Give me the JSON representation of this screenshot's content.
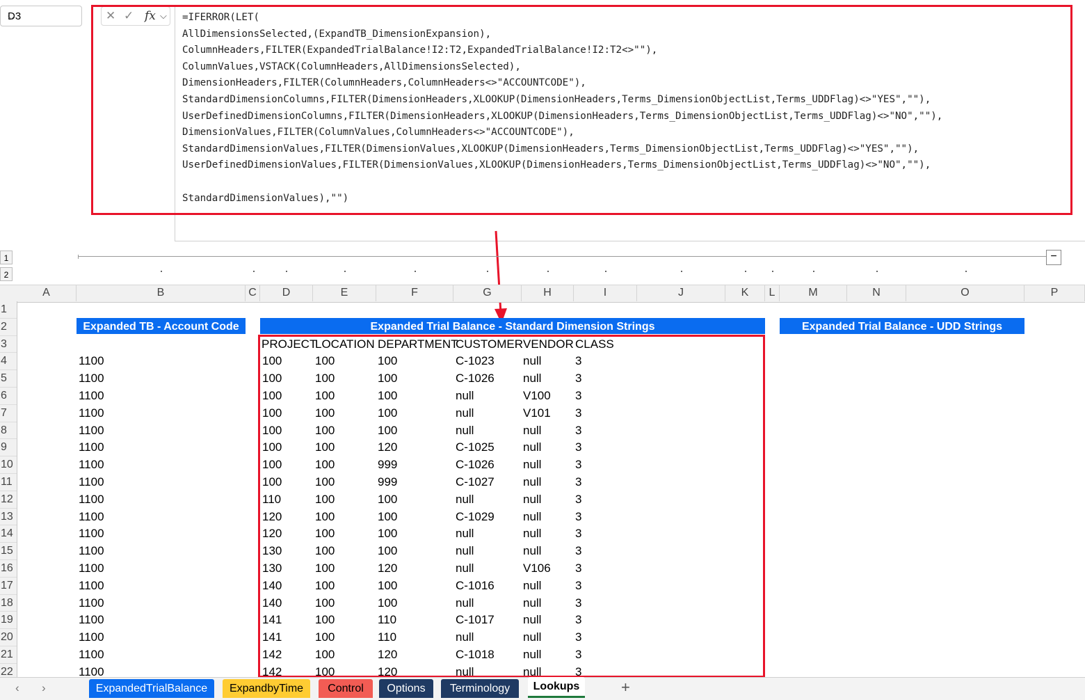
{
  "formula_bar": {
    "name_box": "D3",
    "fx_label": "fx",
    "formula_lines": [
      "=IFERROR(LET(",
      "AllDimensionsSelected,(ExpandTB_DimensionExpansion),",
      "ColumnHeaders,FILTER(ExpandedTrialBalance!I2:T2,ExpandedTrialBalance!I2:T2<>\"\"),",
      "ColumnValues,VSTACK(ColumnHeaders,AllDimensionsSelected),",
      "DimensionHeaders,FILTER(ColumnHeaders,ColumnHeaders<>\"ACCOUNTCODE\"),",
      "StandardDimensionColumns,FILTER(DimensionHeaders,XLOOKUP(DimensionHeaders,Terms_DimensionObjectList,Terms_UDDFlag)<>\"YES\",\"\"),",
      "UserDefinedDimensionColumns,FILTER(DimensionHeaders,XLOOKUP(DimensionHeaders,Terms_DimensionObjectList,Terms_UDDFlag)<>\"NO\",\"\"),",
      "DimensionValues,FILTER(ColumnValues,ColumnHeaders<>\"ACCOUNTCODE\"),",
      "StandardDimensionValues,FILTER(DimensionValues,XLOOKUP(DimensionHeaders,Terms_DimensionObjectList,Terms_UDDFlag)<>\"YES\",\"\"),",
      "UserDefinedDimensionValues,FILTER(DimensionValues,XLOOKUP(DimensionHeaders,Terms_DimensionObjectList,Terms_UDDFlag)<>\"NO\",\"\"),",
      "",
      "StandardDimensionValues),\"\")"
    ]
  },
  "outline": {
    "levels": [
      "1",
      "2"
    ],
    "collapse_symbol": "−"
  },
  "columns": [
    "A",
    "B",
    "C",
    "D",
    "E",
    "F",
    "G",
    "H",
    "I",
    "J",
    "K",
    "L",
    "M",
    "N",
    "O",
    "P"
  ],
  "rows": [
    "1",
    "2",
    "3",
    "4",
    "5",
    "6",
    "7",
    "8",
    "9",
    "10",
    "11",
    "12",
    "13",
    "14",
    "15",
    "16",
    "17",
    "18",
    "19",
    "20",
    "21",
    "22"
  ],
  "banners": {
    "account_code": "Expanded TB - Account Code",
    "standard_dims": "Expanded Trial Balance - Standard Dimension Strings",
    "udd_strings": "Expanded Trial Balance - UDD Strings"
  },
  "table": {
    "headers": [
      "PROJECT",
      "LOCATION",
      "DEPARTMENT",
      "CUSTOMER",
      "VENDOR",
      "CLASS"
    ],
    "rows": [
      [
        "1100",
        "100",
        "100",
        "100",
        "C-1023",
        "null",
        "3"
      ],
      [
        "1100",
        "100",
        "100",
        "100",
        "C-1026",
        "null",
        "3"
      ],
      [
        "1100",
        "100",
        "100",
        "100",
        "null",
        "V100",
        "3"
      ],
      [
        "1100",
        "100",
        "100",
        "100",
        "null",
        "V101",
        "3"
      ],
      [
        "1100",
        "100",
        "100",
        "100",
        "null",
        "null",
        "3"
      ],
      [
        "1100",
        "100",
        "100",
        "120",
        "C-1025",
        "null",
        "3"
      ],
      [
        "1100",
        "100",
        "100",
        "999",
        "C-1026",
        "null",
        "3"
      ],
      [
        "1100",
        "100",
        "100",
        "999",
        "C-1027",
        "null",
        "3"
      ],
      [
        "1100",
        "110",
        "100",
        "100",
        "null",
        "null",
        "3"
      ],
      [
        "1100",
        "120",
        "100",
        "100",
        "C-1029",
        "null",
        "3"
      ],
      [
        "1100",
        "120",
        "100",
        "100",
        "null",
        "null",
        "3"
      ],
      [
        "1100",
        "130",
        "100",
        "100",
        "null",
        "null",
        "3"
      ],
      [
        "1100",
        "130",
        "100",
        "120",
        "null",
        "V106",
        "3"
      ],
      [
        "1100",
        "140",
        "100",
        "100",
        "C-1016",
        "null",
        "3"
      ],
      [
        "1100",
        "140",
        "100",
        "100",
        "null",
        "null",
        "3"
      ],
      [
        "1100",
        "141",
        "100",
        "110",
        "C-1017",
        "null",
        "3"
      ],
      [
        "1100",
        "141",
        "100",
        "110",
        "null",
        "null",
        "3"
      ],
      [
        "1100",
        "142",
        "100",
        "120",
        "C-1018",
        "null",
        "3"
      ],
      [
        "1100",
        "142",
        "100",
        "120",
        "null",
        "null",
        "3"
      ]
    ]
  },
  "sheet_tabs": [
    {
      "label": "ExpandedTrialBalance",
      "color": "#0a6cf0",
      "text_color": "#ffffff"
    },
    {
      "label": "ExpandbyTime",
      "color": "#ffcc33",
      "text_color": "#000000"
    },
    {
      "label": "Control",
      "color": "#f25c54",
      "text_color": "#000000"
    },
    {
      "label": "Options",
      "color": "#1f3a63",
      "text_color": "#ffffff"
    },
    {
      "label": "Terminology",
      "color": "#1f3a63",
      "text_color": "#ffffff"
    },
    {
      "label": "Lookups",
      "color": "#ffffff",
      "text_color": "#000000",
      "active": true
    }
  ],
  "add_sheet": "+",
  "colors": {
    "accent": "#0a6cf0",
    "highlight_border": "#e8142a"
  }
}
